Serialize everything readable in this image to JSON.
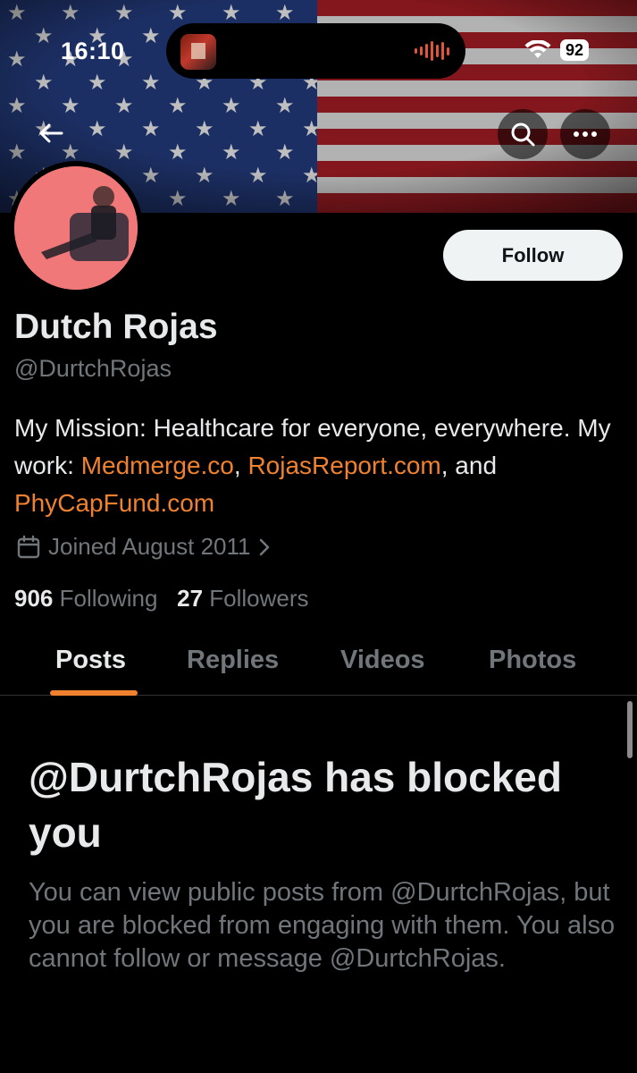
{
  "status_bar": {
    "time": "16:10",
    "battery": "92",
    "wifi_icon": "wifi-icon",
    "audio_wave_icon": "audio-wave-icon"
  },
  "header": {
    "back_icon": "arrow-left-icon",
    "search_icon": "search-icon",
    "more_icon": "ellipsis-icon"
  },
  "profile": {
    "name": "Dutch Rojas",
    "handle": "@DurtchRojas",
    "follow_label": "Follow",
    "bio": {
      "text1": "My Mission: Healthcare for everyone, everywhere. My work: ",
      "link1": "Medmerge.co",
      "sep1": ",",
      "link2": "RojasReport.com",
      "sep2": ", and ",
      "link3": "PhyCapFund.com"
    },
    "joined": "Joined August 2011",
    "following_count": "906",
    "following_label": "Following",
    "followers_count": "27",
    "followers_label": "Followers"
  },
  "tabs": [
    {
      "label": "Posts",
      "active": true
    },
    {
      "label": "Replies",
      "active": false
    },
    {
      "label": "Videos",
      "active": false
    },
    {
      "label": "Photos",
      "active": false
    }
  ],
  "blocked": {
    "title": "@DurtchRojas has blocked you",
    "description": "You can view public posts from @DurtchRojas, but you are blocked from engaging with them. You also cannot follow or message @DurtchRojas."
  },
  "colors": {
    "accent": "#f0812f",
    "background": "#000000",
    "muted_text": "#71767b",
    "primary_text": "#e7e9ea"
  }
}
